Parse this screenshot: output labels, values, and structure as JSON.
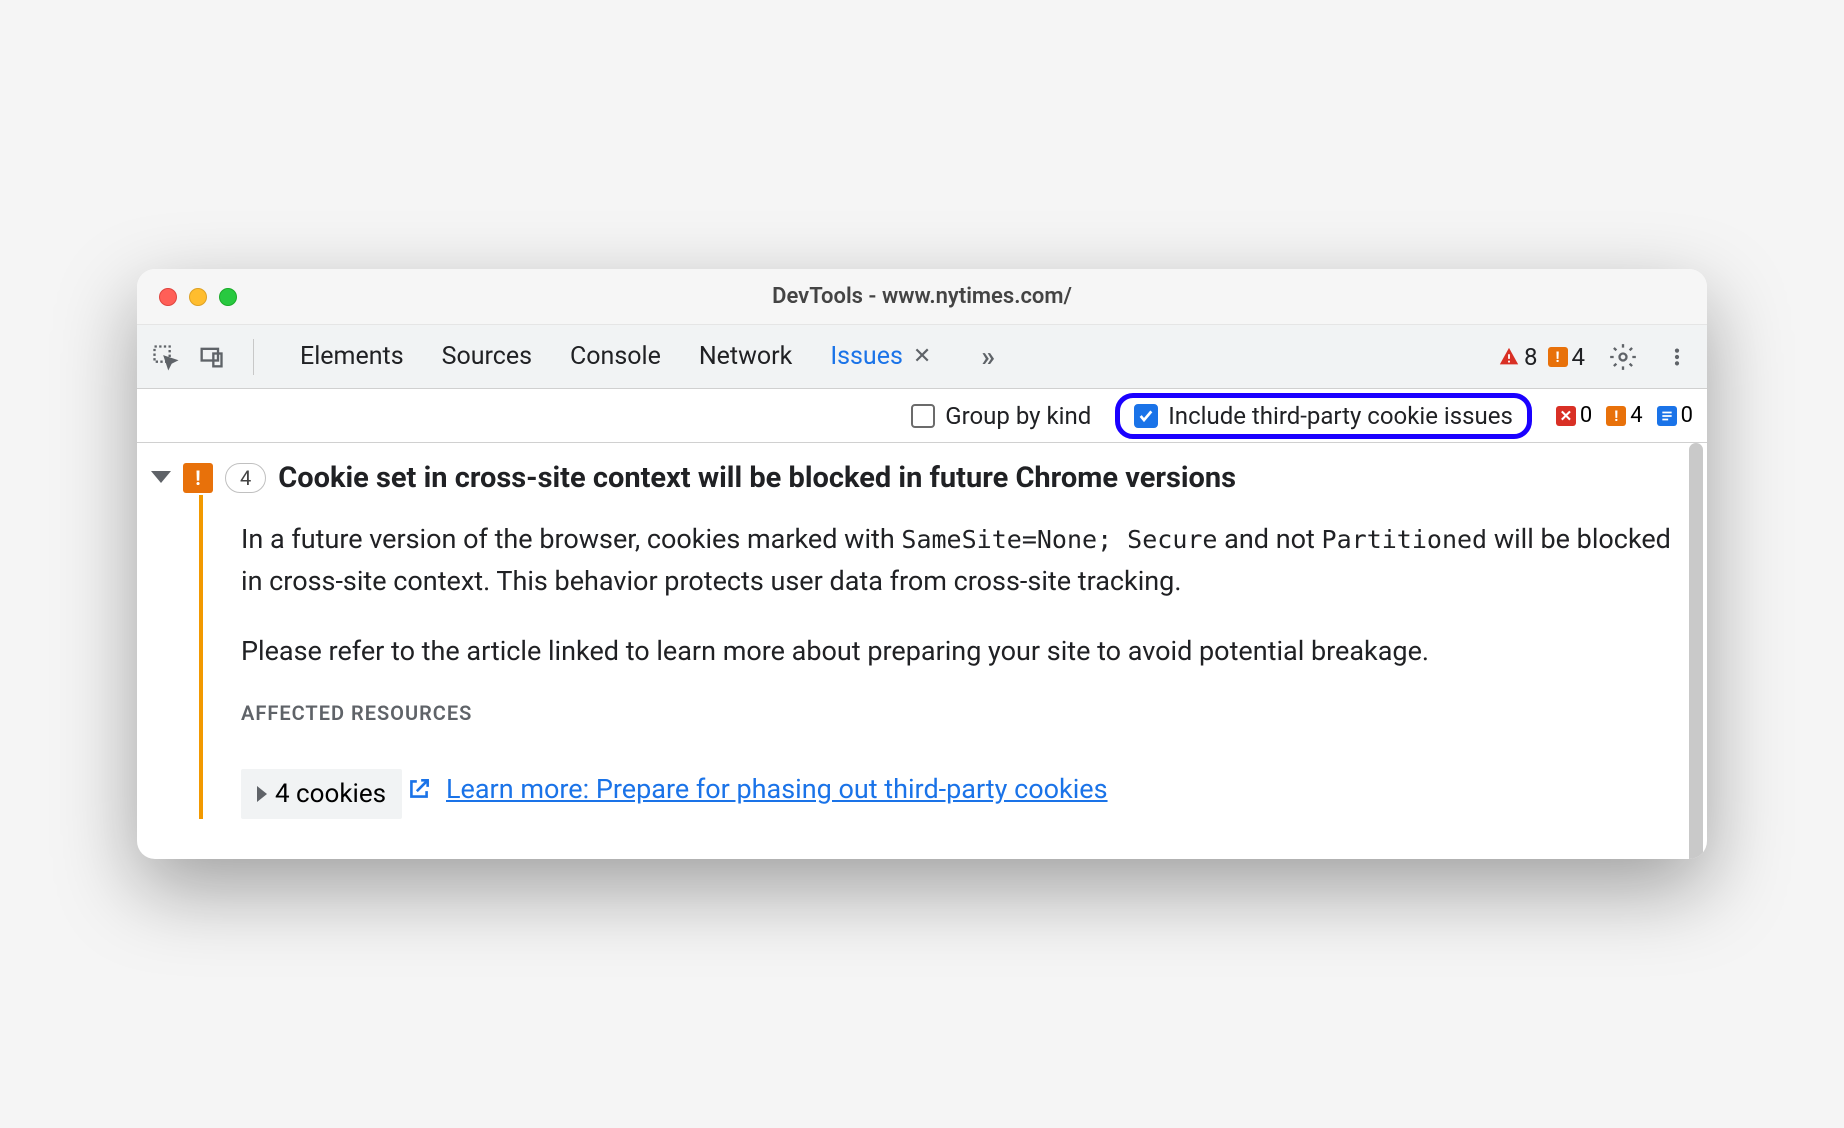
{
  "window": {
    "title": "DevTools - www.nytimes.com/"
  },
  "tabs": {
    "elements": "Elements",
    "sources": "Sources",
    "console": "Console",
    "network": "Network",
    "issues": "Issues"
  },
  "topBadges": {
    "errors": "8",
    "warnings": "4"
  },
  "filters": {
    "groupByKind": "Group by kind",
    "includeThirdParty": "Include third-party cookie issues"
  },
  "filterCounts": {
    "errors": "0",
    "warnings": "4",
    "info": "0"
  },
  "issue": {
    "pillCount": "4",
    "title": "Cookie set in cross-site context will be blocked in future Chrome versions",
    "para1Prefix": "In a future version of the browser, cookies marked with ",
    "para1Code1": "SameSite=None; Secure",
    "para1Mid": " and not ",
    "para1Code2": "Partitioned",
    "para1Suffix": " will be blocked in cross-site context. This behavior protects user data from cross-site tracking.",
    "para2": "Please refer to the article linked to learn more about preparing your site to avoid potential breakage.",
    "affectedLabel": "AFFECTED RESOURCES",
    "cookiesExpand": "4 cookies",
    "learnMore": "Learn more: Prepare for phasing out third-party cookies"
  }
}
